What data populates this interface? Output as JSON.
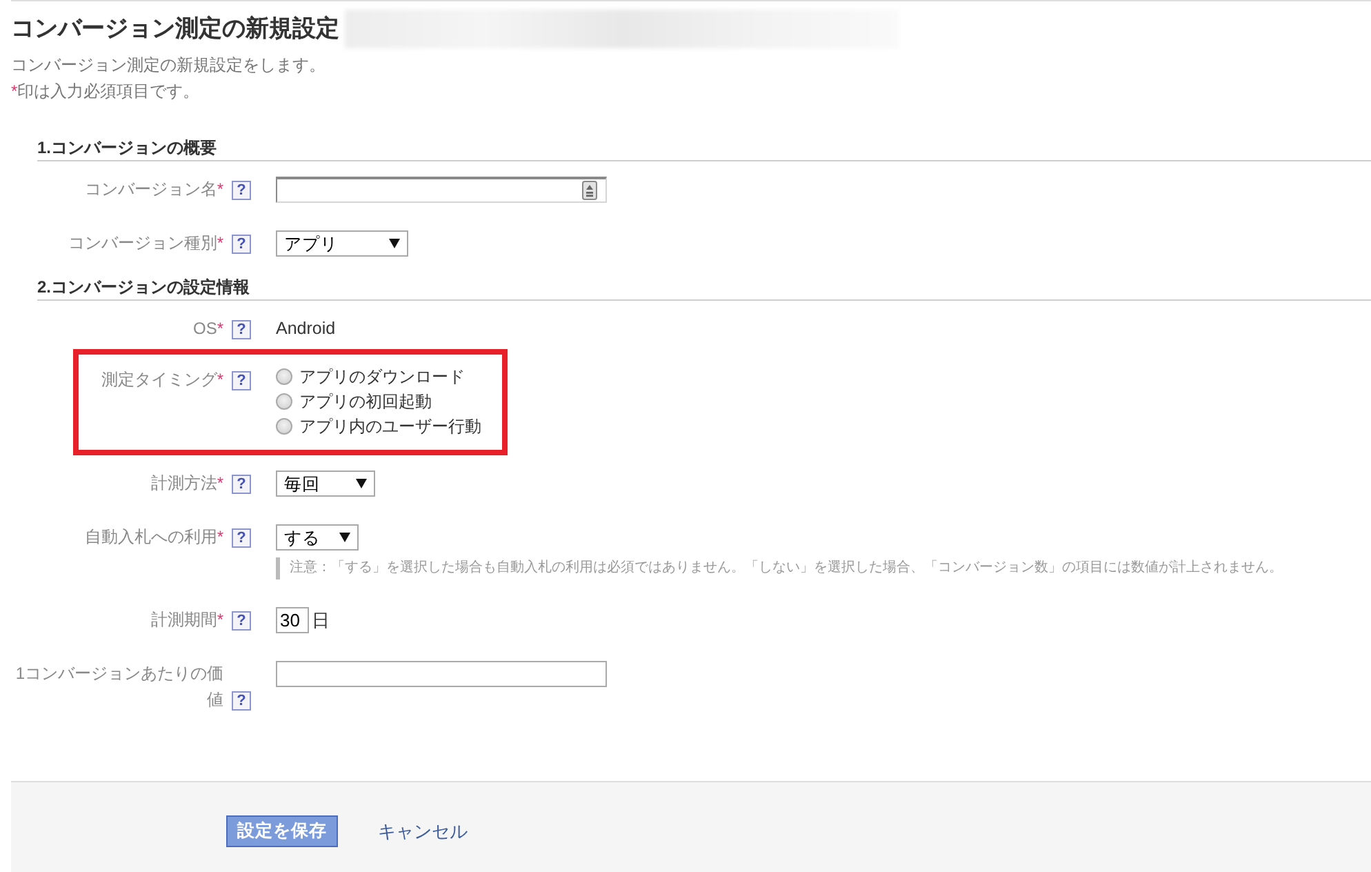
{
  "page": {
    "title": "コンバージョン測定の新規設定",
    "description": "コンバージョン測定の新規設定をします。",
    "required_note": {
      "mark": "*",
      "text": "印は入力必須項目です。"
    }
  },
  "sections": [
    {
      "heading": "1.コンバージョンの概要",
      "fields": [
        {
          "kind": "text",
          "label": "コンバージョン名",
          "required_mark": "*",
          "help": "?",
          "helper_icon": true
        },
        {
          "kind": "select",
          "label": "コンバージョン種別",
          "required_mark": "*",
          "help": "?",
          "value": "アプリ"
        }
      ]
    },
    {
      "heading": "2.コンバージョンの設定情報",
      "fields": [
        {
          "kind": "static",
          "label": "OS",
          "required_mark": "*",
          "help": "?",
          "value": "Android"
        },
        {
          "kind": "radio",
          "label": "測定タイミング",
          "required_mark": "*",
          "help": "?",
          "highlighted": true,
          "options": [
            {
              "label": "アプリのダウンロード",
              "selected": false
            },
            {
              "label": "アプリの初回起動",
              "selected": false
            },
            {
              "label": "アプリ内のユーザー行動",
              "selected": false
            }
          ]
        },
        {
          "kind": "select",
          "label": "計測方法",
          "required_mark": "*",
          "help": "?",
          "value": "毎回"
        },
        {
          "kind": "select",
          "label": "自動入札への利用",
          "required_mark": "*",
          "help": "?",
          "value": "する",
          "note": "注意：「する」を選択した場合も自動入札の利用は必須ではありません。「しない」を選択した場合、「コンバージョン数」の項目には数値が計上されません。"
        },
        {
          "kind": "number",
          "label": "計測期間",
          "required_mark": "*",
          "help": "?",
          "value": "30",
          "unit": "日"
        },
        {
          "kind": "text",
          "label": "1コンバージョンあたりの価値",
          "help": "?"
        }
      ]
    }
  ],
  "footer": {
    "save_button": "設定を保存",
    "cancel_link": "キャンセル"
  }
}
